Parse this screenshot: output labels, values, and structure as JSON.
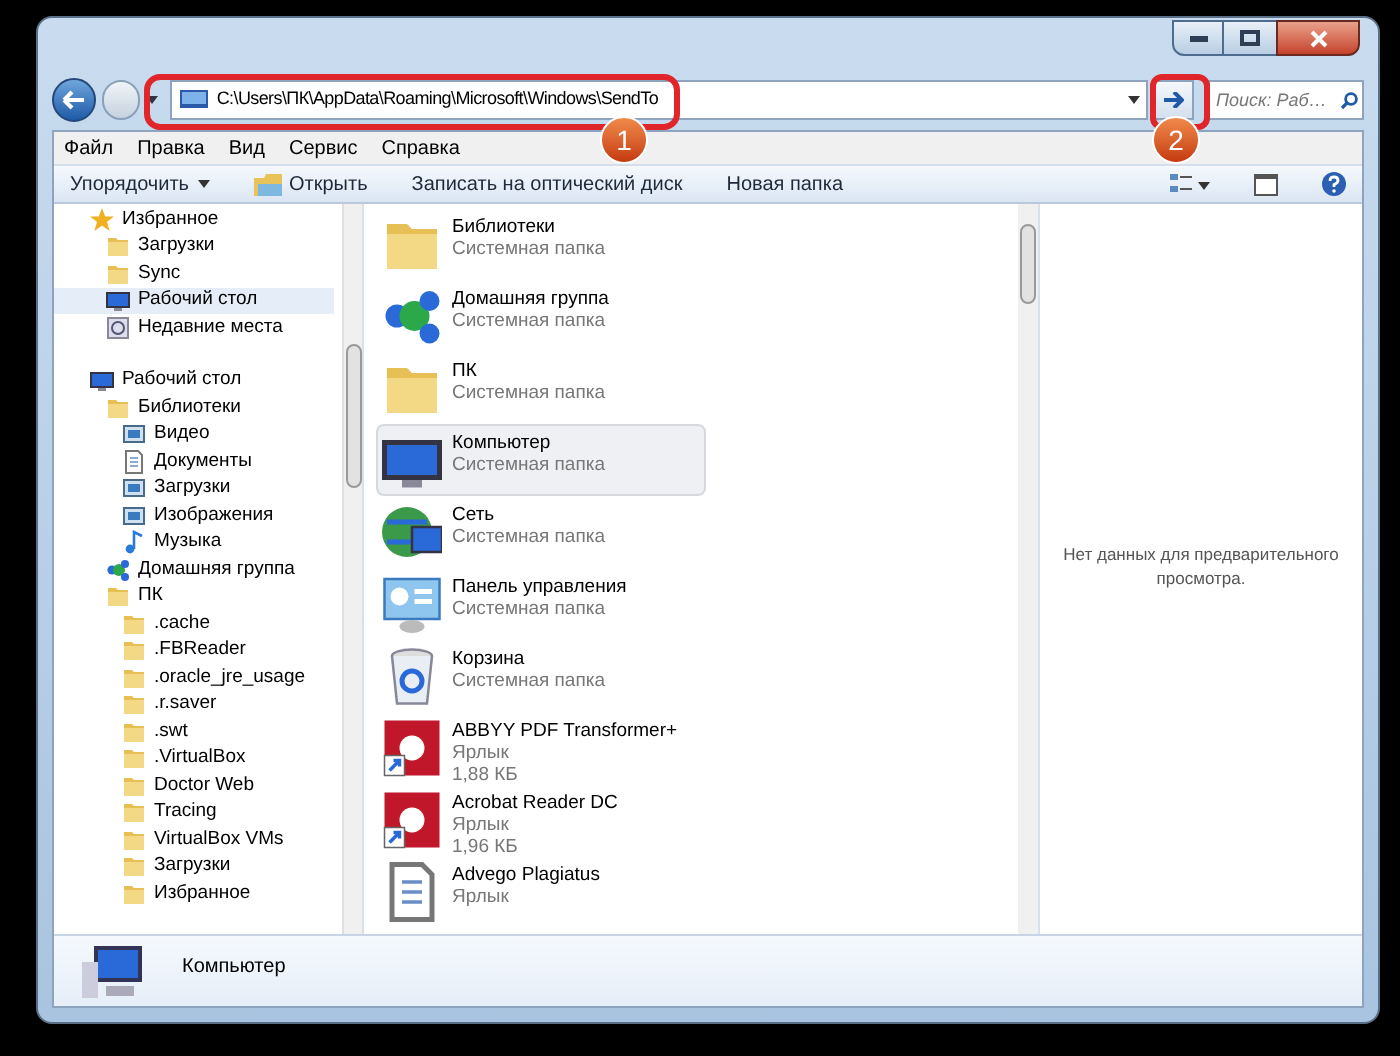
{
  "address_bar": {
    "path": "C:\\Users\\ПК\\AppData\\Roaming\\Microsoft\\Windows\\SendTo"
  },
  "search": {
    "placeholder": "Поиск: Раб…"
  },
  "menu": [
    "Файл",
    "Правка",
    "Вид",
    "Сервис",
    "Справка"
  ],
  "toolbar": [
    {
      "label": "Упорядочить",
      "kind": "dropdown"
    },
    {
      "label": "Открыть",
      "kind": "icon"
    },
    {
      "label": "Записать на оптический диск",
      "kind": "plain"
    },
    {
      "label": "Новая папка",
      "kind": "plain"
    }
  ],
  "navigation": [
    {
      "label": "Избранное",
      "kind": "star",
      "selected": false,
      "children": [
        {
          "label": "Загрузки",
          "kind": "folder",
          "selected": false
        },
        {
          "label": "Sync",
          "kind": "folder",
          "selected": false
        },
        {
          "label": "Рабочий стол",
          "kind": "monitor",
          "selected": true
        },
        {
          "label": "Недавние места",
          "kind": "recent",
          "selected": false
        }
      ]
    },
    {
      "label": "Рабочий стол",
      "kind": "monitor",
      "selected": false,
      "children": [
        {
          "label": "Библиотеки",
          "kind": "folder",
          "selected": false,
          "children": [
            {
              "label": "Видео",
              "kind": "media",
              "selected": false
            },
            {
              "label": "Документы",
              "kind": "document",
              "selected": false
            },
            {
              "label": "Загрузки",
              "kind": "media",
              "selected": false
            },
            {
              "label": "Изображения",
              "kind": "media",
              "selected": false
            },
            {
              "label": "Музыка",
              "kind": "music",
              "selected": false
            }
          ]
        },
        {
          "label": "Домашняя группа",
          "kind": "network",
          "selected": false
        },
        {
          "label": "ПК",
          "kind": "folder",
          "selected": false,
          "children": [
            {
              "label": ".cache",
              "kind": "folder",
              "selected": false
            },
            {
              "label": ".FBReader",
              "kind": "folder",
              "selected": false
            },
            {
              "label": ".oracle_jre_usage",
              "kind": "folder",
              "selected": false
            },
            {
              "label": ".r.saver",
              "kind": "folder",
              "selected": false
            },
            {
              "label": ".swt",
              "kind": "folder",
              "selected": false
            },
            {
              "label": ".VirtualBox",
              "kind": "folder",
              "selected": false
            },
            {
              "label": "Doctor Web",
              "kind": "folder",
              "selected": false
            },
            {
              "label": "Tracing",
              "kind": "folder",
              "selected": false
            },
            {
              "label": "VirtualBox VMs",
              "kind": "folder",
              "selected": false
            },
            {
              "label": "Загрузки",
              "kind": "folder",
              "selected": false
            },
            {
              "label": "Избранное",
              "kind": "folder",
              "selected": false
            }
          ]
        }
      ]
    }
  ],
  "items": [
    {
      "name": "Библиотеки",
      "type": "Системная папка",
      "kind": "folder",
      "selected": false
    },
    {
      "name": "Домашняя группа",
      "type": "Системная папка",
      "kind": "network",
      "selected": false
    },
    {
      "name": "ПК",
      "type": "Системная папка",
      "kind": "folder",
      "selected": false
    },
    {
      "name": "Компьютер",
      "type": "Системная папка",
      "kind": "monitor",
      "selected": true
    },
    {
      "name": "Сеть",
      "type": "Системная папка",
      "kind": "globe",
      "selected": false
    },
    {
      "name": "Панель управления",
      "type": "Системная папка",
      "kind": "panel",
      "selected": false
    },
    {
      "name": "Корзина",
      "type": "Системная папка",
      "kind": "bin",
      "selected": false
    },
    {
      "name": "ABBYY PDF Transformer+",
      "type": "Ярлык",
      "size": "1,88 КБ",
      "kind": "shortcut",
      "selected": false
    },
    {
      "name": "Acrobat Reader DC",
      "type": "Ярлык",
      "size": "1,96 КБ",
      "kind": "shortcut",
      "selected": false
    },
    {
      "name": "Advego Plagiatus",
      "type": "Ярлык",
      "kind": "document",
      "selected": false
    }
  ],
  "preview": {
    "message": "Нет данных для предварительного просмотра."
  },
  "details": {
    "name": "Компьютер"
  },
  "annotations": [
    {
      "label": "1"
    },
    {
      "label": "2"
    }
  ]
}
